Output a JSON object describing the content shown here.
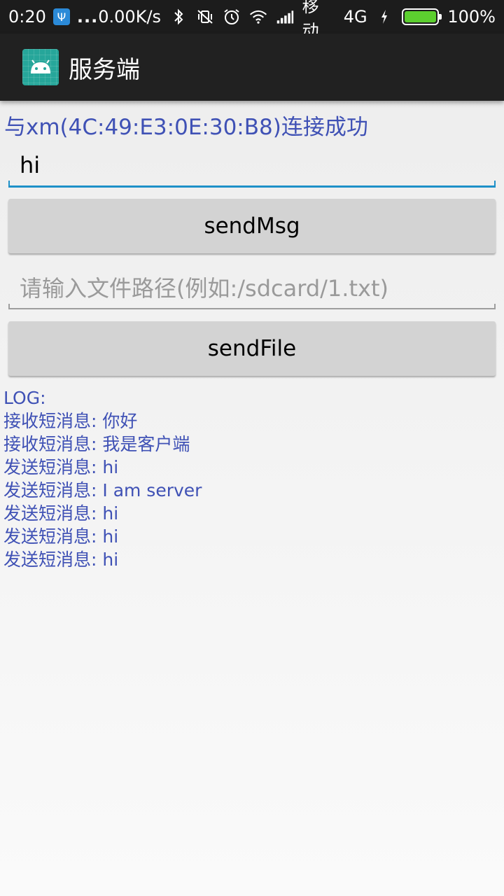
{
  "status_bar": {
    "time": "0:20",
    "dots": "...",
    "speed": "0.00K/s",
    "carrier": "移动",
    "network": "4G",
    "battery": "100%"
  },
  "app_bar": {
    "title": "服务端",
    "icon": "android-icon"
  },
  "main": {
    "connection_status": "与xm(4C:49:E3:0E:30:B8)连接成功",
    "message_input": {
      "value": "hi"
    },
    "send_msg_button": "sendMsg",
    "file_path_input": {
      "value": "",
      "placeholder": "请输入文件路径(例如:/sdcard/1.txt)"
    },
    "send_file_button": "sendFile"
  },
  "log": {
    "header": "LOG:",
    "lines": [
      "接收短消息: 你好",
      "接收短消息: 我是客户端",
      "发送短消息: hi",
      "发送短消息: I am server",
      "发送短消息: hi",
      "发送短消息: hi",
      "发送短消息: hi"
    ]
  },
  "colors": {
    "accent": "#3f51b5",
    "input_underline_active": "#1e90c8",
    "battery": "#5ccf2f",
    "app_icon": "#26a69a"
  }
}
